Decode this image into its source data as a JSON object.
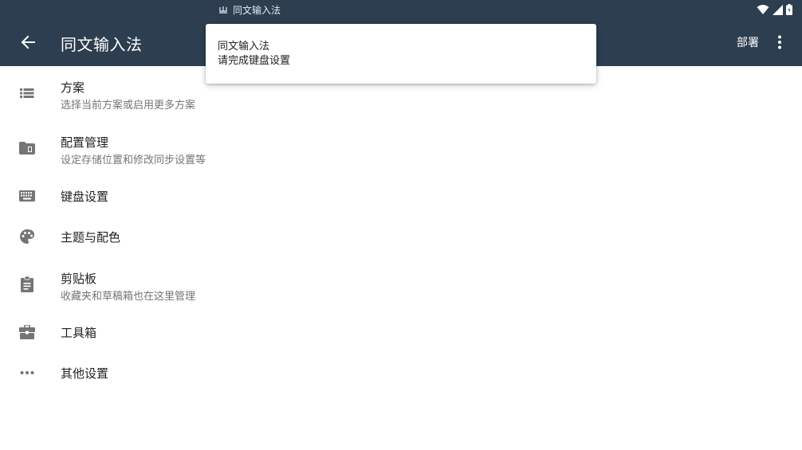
{
  "status_bar": {
    "app_name": "同文输入法"
  },
  "app_bar": {
    "title": "同文输入法",
    "deploy_label": "部署"
  },
  "notification": {
    "title": "同文输入法",
    "text": "请完成键盘设置"
  },
  "menu": [
    {
      "icon": "list-icon",
      "title": "方案",
      "subtitle": "选择当前方案或启用更多方案"
    },
    {
      "icon": "folder-icon",
      "title": "配置管理",
      "subtitle": "设定存储位置和修改同步设置等"
    },
    {
      "icon": "keyboard-icon",
      "title": "键盘设置",
      "subtitle": ""
    },
    {
      "icon": "palette-icon",
      "title": "主题与配色",
      "subtitle": ""
    },
    {
      "icon": "clipboard-icon",
      "title": "剪贴板",
      "subtitle": "收藏夹和草稿箱也在这里管理"
    },
    {
      "icon": "toolbox-icon",
      "title": "工具箱",
      "subtitle": ""
    },
    {
      "icon": "more-horiz-icon",
      "title": "其他设置",
      "subtitle": ""
    }
  ],
  "colors": {
    "app_bar": "#2d3e50",
    "icon": "#757575",
    "text_primary": "#212121",
    "text_secondary": "#757575"
  }
}
